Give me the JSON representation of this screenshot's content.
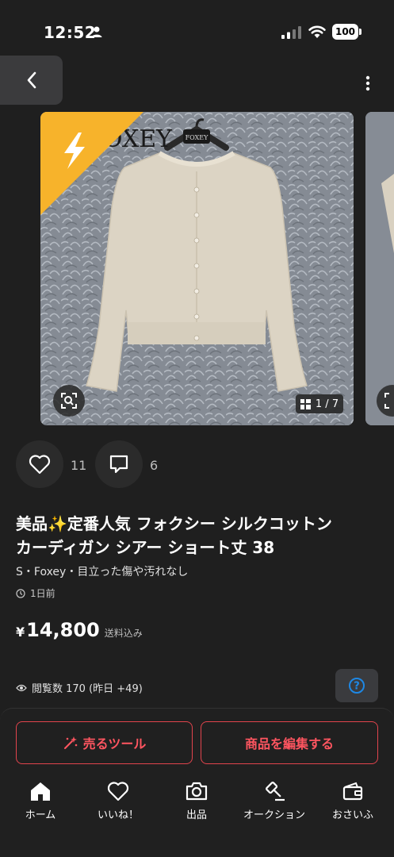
{
  "status": {
    "time": "12:52",
    "battery": "100"
  },
  "product_image": {
    "counter": "1 / 7",
    "brand_tag": "FOXEY",
    "watermark": "FOXEY"
  },
  "actions": {
    "likes": "11",
    "comments": "6"
  },
  "product": {
    "title_line1": "美品✨定番人気 フォクシー シルクコットン",
    "title_line2": "カーディガン シアー ショート丈 38",
    "meta": "S・Foxey・目立った傷や汚れなし",
    "posted": "1日前",
    "price_currency": "¥",
    "price": "14,800",
    "price_note": "送料込み",
    "views": "閲覧数  170 (昨日 +49)"
  },
  "buttons": {
    "sell_tool": "売るツール",
    "edit_item": "商品を編集する"
  },
  "tabs": [
    {
      "label": "ホーム",
      "icon": "home-icon"
    },
    {
      "label": "いいね！",
      "icon": "heart-icon"
    },
    {
      "label": "出品",
      "icon": "camera-icon"
    },
    {
      "label": "オークション",
      "icon": "gavel-icon"
    },
    {
      "label": "おさいふ",
      "icon": "wallet-icon"
    }
  ],
  "colors": {
    "background": "#1f1f1f",
    "accent": "#ff5560",
    "badge": "#f7b32b",
    "help": "#1e88e5"
  }
}
